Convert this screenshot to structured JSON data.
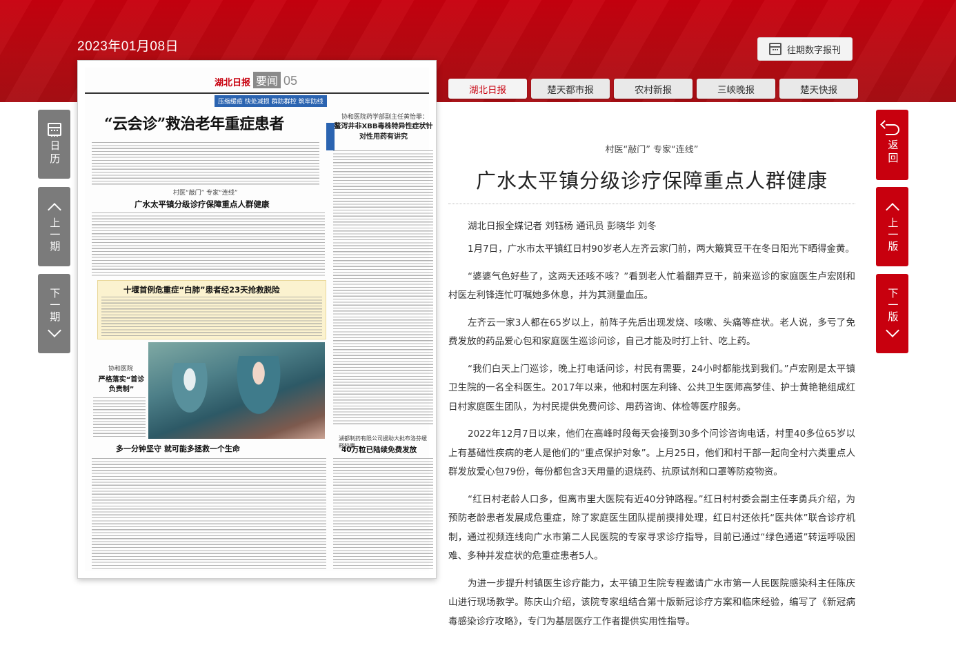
{
  "header": {
    "date": "2023年01月08日",
    "archive_label": "往期数字报刊",
    "tabs": [
      "湖北日报",
      "楚天都市报",
      "农村新报",
      "三峡晚报",
      "楚天快报"
    ],
    "active_tab": "湖北日报"
  },
  "left_nav": {
    "calendar": "日历",
    "prev_issue": "上一期",
    "next_issue": "下一期"
  },
  "right_nav": {
    "back": "返回",
    "prev_page": "上一版",
    "next_page": "下一版"
  },
  "paper": {
    "logo": "湖北日报",
    "section": "要闻",
    "page_num": "05",
    "banner": "压缩缓疫  快处减损  群防群控  筑牢防线",
    "main_headline": "“云会诊”救治老年重症患者",
    "right_kicker": "协和医院药学部副主任黄怡菲：",
    "right_headline": "鳌泻井非XBB毒株特异性症状针对性用药有讲究",
    "sub_kicker": "村医“敲门”  专家“连线”",
    "sub_headline": "广水太平镇分级诊疗保障重点人群健康",
    "yellow_headline": "十堰首例危重症“白肺”患者经23天抢救脱险",
    "left_kicker": "协和医院",
    "left_headline": "严格落实“首诊负责制”",
    "bottom_headline": "多一分钟坚守  就可能多拯救一个生命",
    "bottom_right_kicker": "湖都制药有限公司援助大批布洛芬缓释胶囊",
    "bottom_right_headline": "40万粒已陆续免费发放"
  },
  "article": {
    "kicker": "村医“敲门”  专家“连线”",
    "title": "广水太平镇分级诊疗保障重点人群健康",
    "byline": "湖北日报全媒记者 刘钰杨 通讯员 彭晓华 刘冬",
    "paragraphs": [
      "1月7日，广水市太平镇红日村90岁老人左齐云家门前，两大簸箕豆干在冬日阳光下晒得金黄。",
      "“婆婆气色好些了，这两天还咳不咳？”看到老人忙着翻弄豆干，前来巡诊的家庭医生卢宏刚和村医左利锋连忙叮嘱她多休息，并为其测量血压。",
      "左齐云一家3人都在65岁以上，前阵子先后出现发烧、咳嗽、头痛等症状。老人说，多亏了免费发放的药品爱心包和家庭医生巡诊问诊，自己才能及时打上针、吃上药。",
      "“我们白天上门巡诊，晚上打电话问诊，村民有需要，24小时都能找到我们。”卢宏刚是太平镇卫生院的一名全科医生。2017年以来，他和村医左利锋、公共卫生医师高梦佳、护士黄艳艳组成红日村家庭医生团队，为村民提供免费问诊、用药咨询、体检等医疗服务。",
      "2022年12月7日以来，他们在高峰时段每天会接到30多个问诊咨询电话，村里40多位65岁以上有基础性疾病的老人是他们的“重点保护对象”。上月25日，他们和村干部一起向全村六类重点人群发放爱心包79份，每份都包含3天用量的退烧药、抗原试剂和口罩等防疫物资。",
      "“红日村老龄人口多，但离市里大医院有近40分钟路程。”红日村村委会副主任李勇兵介绍，为预防老龄患者发展成危重症，除了家庭医生团队提前摸排处理，红日村还依托“医共体”联合诊疗机制，通过视频连线向广水市第二人民医院的专家寻求诊疗指导，目前已通过“绿色通道”转运呼吸困难、多种并发症状的危重症患者5人。",
      "为进一步提升村镇医生诊疗能力，太平镇卫生院专程邀请广水市第一人民医院感染科主任陈庆山进行现场教学。陈庆山介绍，该院专家组结合第十版新冠诊疗方案和临床经验，编写了《新冠病毒感染诊疗攻略》，专门为基层医疗工作者提供实用性指导。"
    ]
  }
}
